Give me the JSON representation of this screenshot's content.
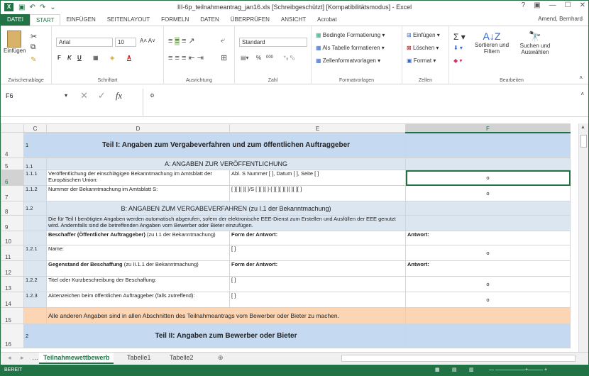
{
  "window": {
    "title": "III-6p_teilnahmeantrag_jan16.xls  [Schreibgeschützt]  [Kompatibilitätsmodus] - Excel",
    "controls": [
      "?",
      "▣",
      "—",
      "☐",
      "✕"
    ]
  },
  "tabs": [
    "DATEI",
    "START",
    "EINFÜGEN",
    "SEITENLAYOUT",
    "FORMELN",
    "DATEN",
    "ÜBERPRÜFEN",
    "ANSICHT",
    "Acrobat"
  ],
  "user": "Amend, Bernhard",
  "ribbon": {
    "clipboard": {
      "paste": "Einfügen",
      "label": "Zwischenablage"
    },
    "font": {
      "name": "Arial",
      "size": "10",
      "label": "Schriftart"
    },
    "alignment": {
      "label": "Ausrichtung"
    },
    "number": {
      "format": "Standard",
      "percent": "%",
      "thousands": "000",
      "label": "Zahl"
    },
    "styles": {
      "cond": "Bedingte Formatierung",
      "table": "Als Tabelle formatieren",
      "cell": "Zellenformatvorlagen",
      "label": "Formatvorlagen"
    },
    "cells": {
      "insert": "Einfügen",
      "delete": "Löschen",
      "format": "Format",
      "label": "Zellen"
    },
    "editing": {
      "sort": "Sortieren und Filtern",
      "find": "Suchen und Auswählen",
      "label": "Bearbeiten"
    }
  },
  "formula": {
    "namebox": "F6",
    "value": "o"
  },
  "columns": [
    "C",
    "D",
    "E",
    "F"
  ],
  "rows": [
    {
      "n": "4",
      "c": "1",
      "d": "Teil I: Angaben zum Vergabeverfahren und zum öffentlichen Auftraggeber",
      "e": "",
      "f": ""
    },
    {
      "n": "5",
      "c": "1.1",
      "d": "A: ANGABEN ZUR VERÖFFENTLICHUNG",
      "e": "",
      "f": ""
    },
    {
      "n": "6",
      "c": "1.1.1",
      "d": "Veröffentlichung der einschlägigen Bekanntmachung im Amtsblatt der Europäischen Union:",
      "e": "Abl. S Nummer [  ], Datum [  ], Seite [  ]",
      "f": "o"
    },
    {
      "n": "7",
      "c": "1.1.2",
      "d": "Nummer der Bekanntmachung im Amtsblatt S:",
      "e": "[  ][  ][  ][  ]/S [  ][  ][  ]-[  ][  ][  ][  ][  ][  ][  ]",
      "f": "o"
    },
    {
      "n": "8",
      "c": "1.2",
      "d": "B: ANGABEN ZUM VERGABEVERFAHREN (zu I.1 der Bekanntmachung)",
      "e": "",
      "f": ""
    },
    {
      "n": "9",
      "c": "",
      "d": "Die für Teil I benötigten Angaben werden automatisch abgerufen, sofern der elektronische EEE-Dienst zum Erstellen und Ausfüllen der EEE genutzt wird. Andernfalls sind die betreffenden Angaben vom Bewerber oder Bieter einzufügen.",
      "e": "",
      "f": ""
    },
    {
      "n": "10",
      "c": "",
      "d_bold": "Beschaffer (Öffentlicher Auftraggeber)",
      "d_rest": " (zu I.1 der Bekanntmachung)",
      "e": "Form der Antwort:",
      "f": "Antwort:"
    },
    {
      "n": "11",
      "c": "1.2.1",
      "d": "Name:",
      "e": "[  ]",
      "f": "o"
    },
    {
      "n": "12",
      "c": "",
      "d_bold": "Gegenstand der Beschaffung",
      "d_rest": " (zu II.1.1 der Bekanntmachung)",
      "e": "Form der Antwort:",
      "f": "Antwort:"
    },
    {
      "n": "13",
      "c": "1.2.2",
      "d": "Titel oder Kurzbeschreibung der Beschaffung:",
      "e": "[  ]",
      "f": "o"
    },
    {
      "n": "14",
      "c": "1.2.3",
      "d": "Aktenzeichen beim öffentlichen Auftraggeber (falls zutreffend):",
      "e": "[  ]",
      "f": "o"
    },
    {
      "n": "15",
      "c": "",
      "d": "Alle anderen Angaben sind in allen Abschnitten des Teilnahmeantrags vom Bewerber oder Bieter zu machen.",
      "e": "",
      "f": ""
    },
    {
      "n": "16",
      "c": "2",
      "d": "Teil II: Angaben zum Bewerber oder Bieter",
      "e": "",
      "f": ""
    }
  ],
  "sheets": [
    "Teilnahmewettbewerb",
    "Tabelle1",
    "Tabelle2"
  ],
  "status": "BEREIT"
}
